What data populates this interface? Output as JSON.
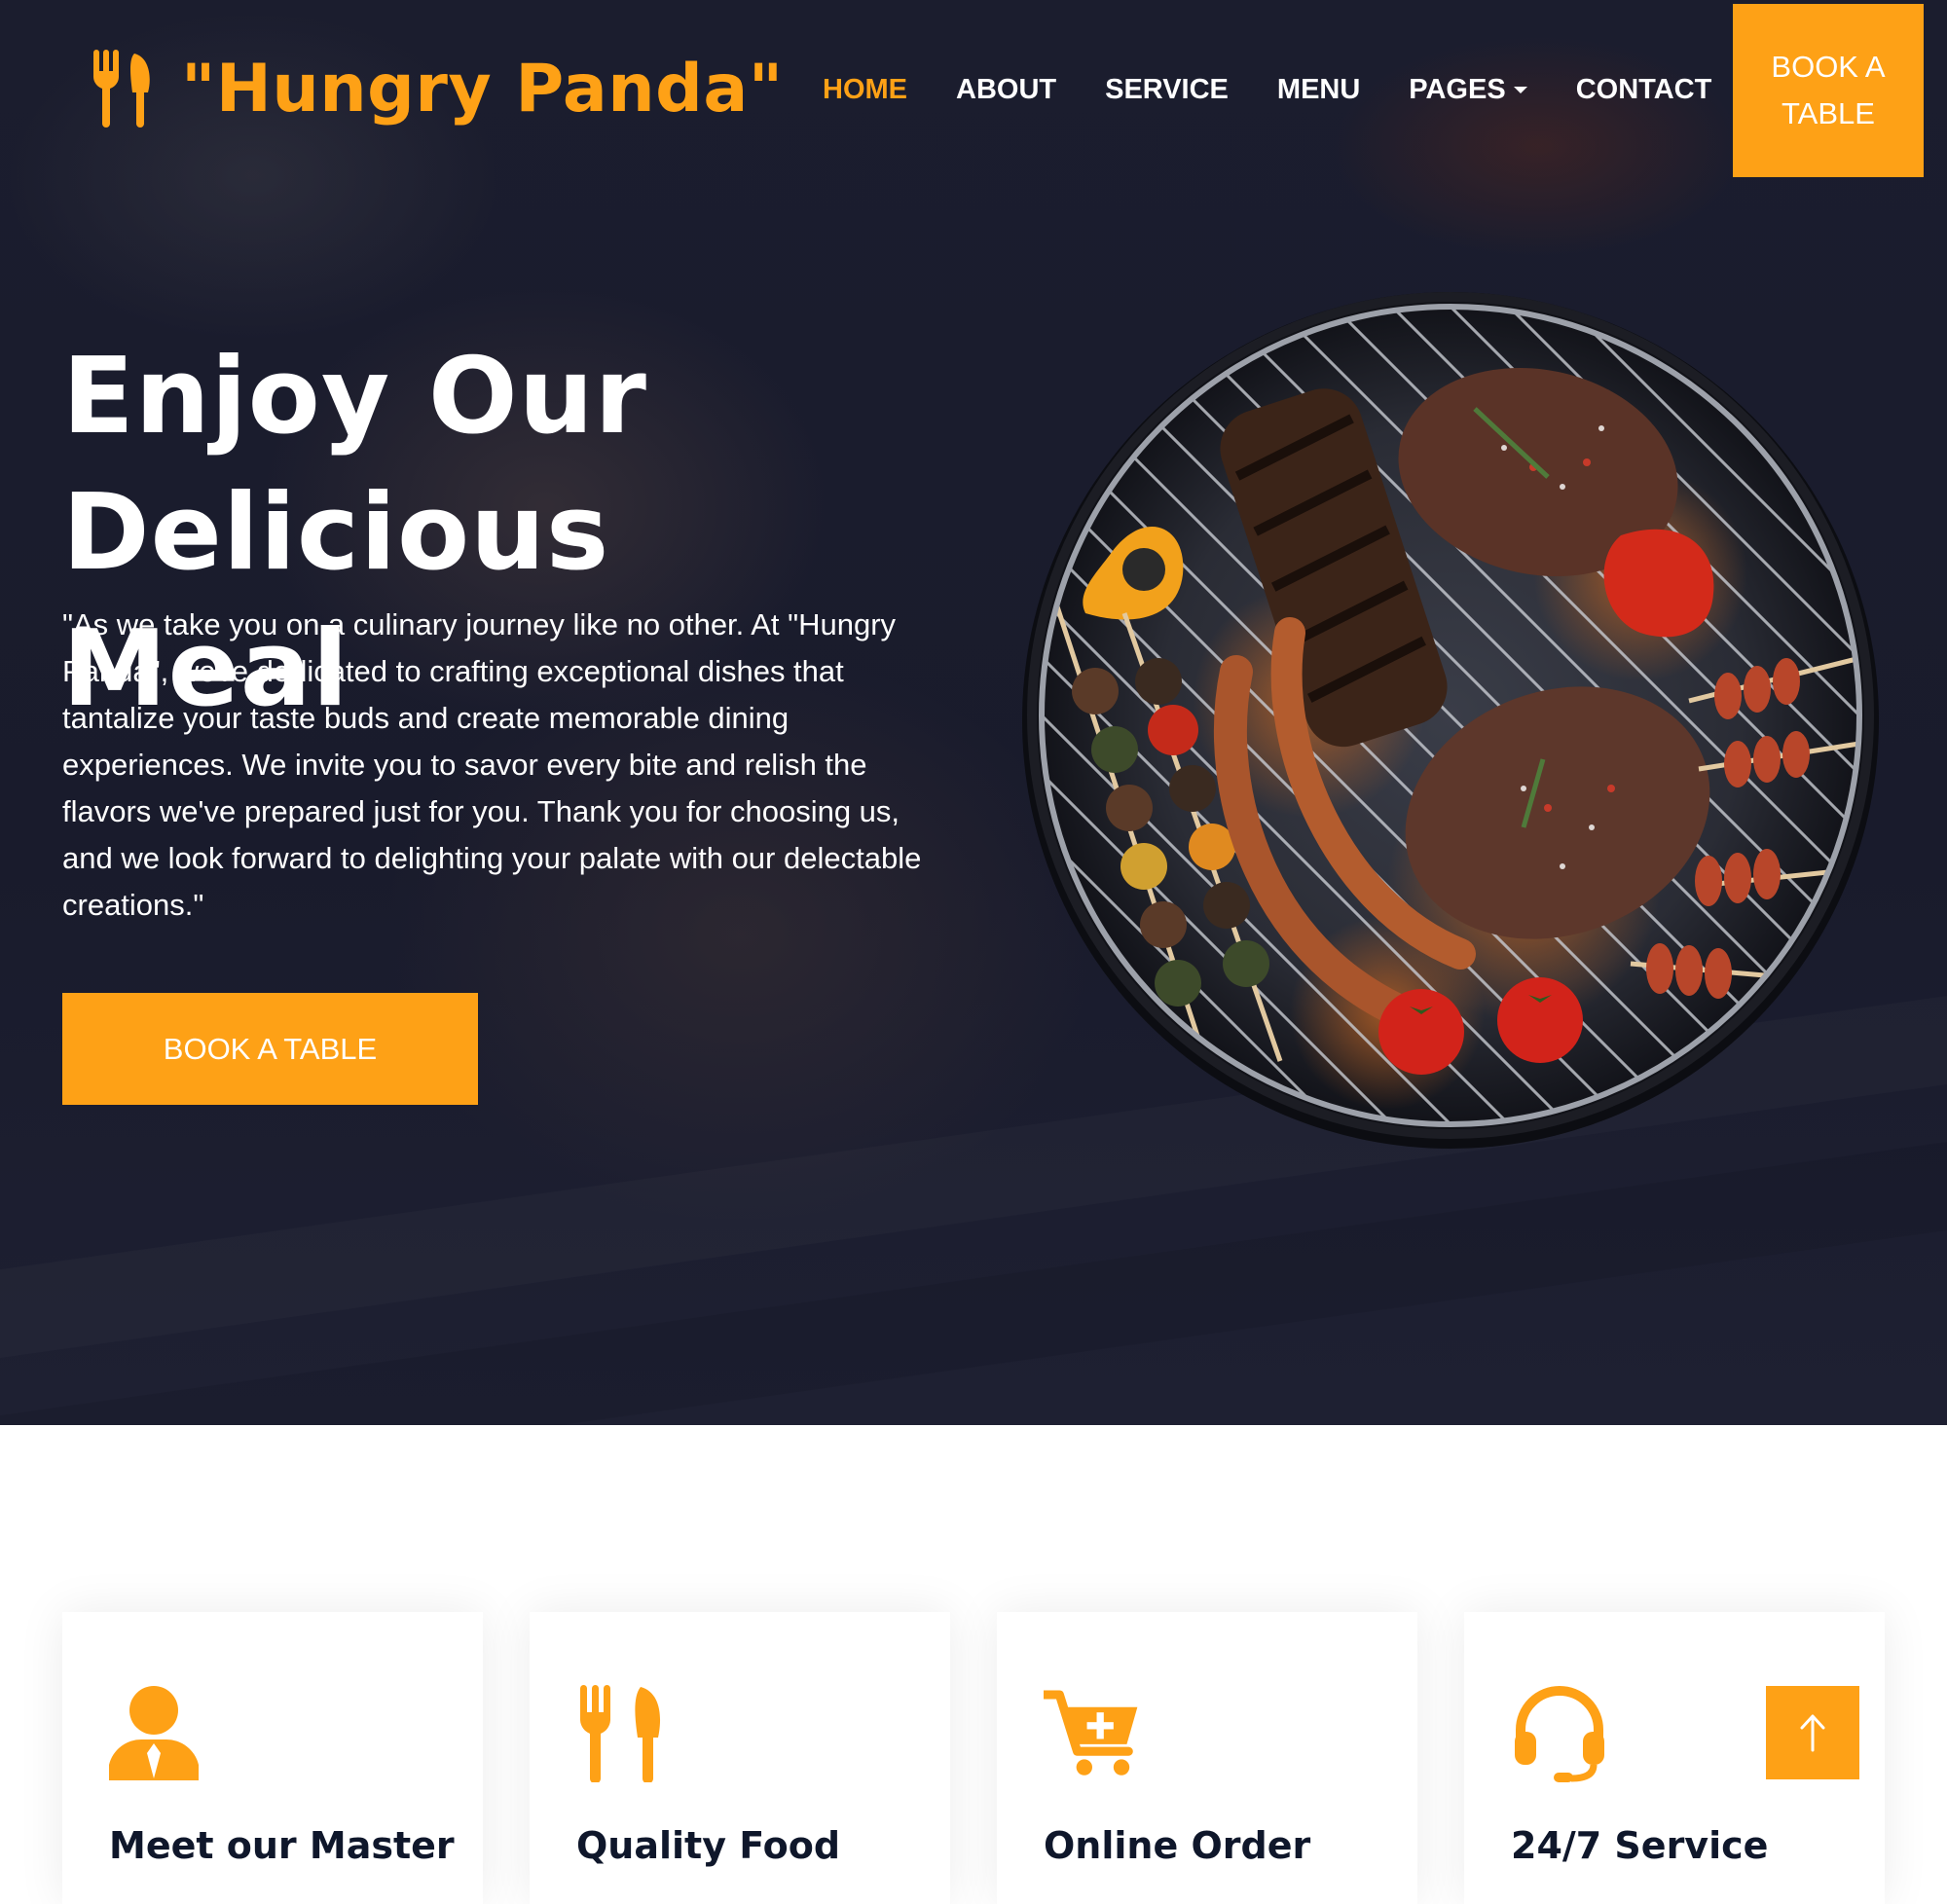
{
  "brand": {
    "name": "\"Hungry Panda\"",
    "icon": "utensils-icon"
  },
  "nav": {
    "items": [
      {
        "label": "HOME",
        "active": true
      },
      {
        "label": "ABOUT",
        "active": false
      },
      {
        "label": "SERVICE",
        "active": false
      },
      {
        "label": "MENU",
        "active": false
      },
      {
        "label": "PAGES",
        "active": false,
        "has_dropdown": true
      },
      {
        "label": "CONTACT",
        "active": false
      }
    ],
    "cta_label": "BOOK A TABLE"
  },
  "hero": {
    "title_line1": "Enjoy Our",
    "title_line2": "Delicious Meal",
    "text": "\"As we take you on a culinary journey like no other. At \"Hungry Panda\", we're dedicated to crafting exceptional dishes that tantalize your taste buds and create memorable dining experiences. We invite you to savor every bite and relish the flavors we've prepared just for you. Thank you for choosing us, and we look forward to delighting your palate with our delectable creations.\"",
    "button_label": "BOOK A TABLE"
  },
  "services": [
    {
      "title": "Meet our Master",
      "icon": "chef-icon"
    },
    {
      "title": "Quality Food",
      "icon": "utensils-icon"
    },
    {
      "title": "Online Order",
      "icon": "cart-plus-icon"
    },
    {
      "title": "24/7 Service",
      "icon": "headset-icon"
    }
  ],
  "back_to_top": {
    "icon": "arrow-up-icon"
  },
  "colors": {
    "accent": "#fea116",
    "hero_bg": "#1b1d2e",
    "heading_dark": "#0f172b",
    "white": "#ffffff"
  }
}
